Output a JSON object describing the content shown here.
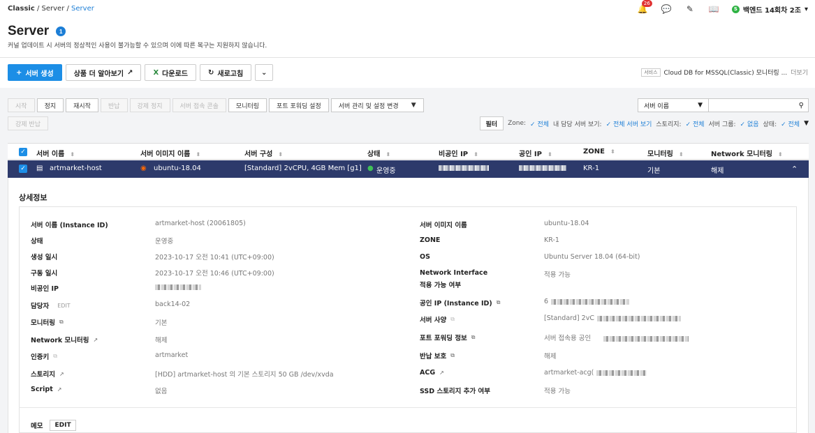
{
  "breadcrumb": {
    "root": "Classic",
    "mid": "Server",
    "current": "Server"
  },
  "top": {
    "notif_count": "26",
    "user_initial": "S",
    "user_name": "백엔드 14회차 2조"
  },
  "page": {
    "title": "Server",
    "count": "1",
    "description": "커널 업데이트 시 서버의 정상적인 사용이 불가능할 수 있으며 이에 따른 복구는 지원하지 않습니다."
  },
  "actions": {
    "create": "서버 생성",
    "learn_more": "상품 더 알아보기",
    "download": "다운로드",
    "refresh": "새로고침"
  },
  "notice": {
    "tag": "서비스",
    "text": "Cloud DB for MSSQL(Classic) 모니터링 ...",
    "more": "더보기"
  },
  "toolbar": {
    "start": "시작",
    "stop": "정지",
    "restart": "재시작",
    "return": "반납",
    "force_stop": "강제 정지",
    "console": "서버 접속 콘솔",
    "monitoring": "모니터링",
    "port_forward": "포트 포워딩 설정",
    "manage": "서버 관리 및 설정 변경",
    "force_return": "강제 반납"
  },
  "search": {
    "field": "서버 이름",
    "placeholder": ""
  },
  "filter": {
    "label": "필터",
    "zone_label": "Zone:",
    "zone_val": "전체",
    "mine_label": "내 담당 서버 보기:",
    "mine_val": "전체 서버 보기",
    "storage_label": "스토리지:",
    "storage_val": "전체",
    "group_label": "서버 그룹:",
    "group_val": "없음",
    "state_label": "상태:",
    "state_val": "전체"
  },
  "table": {
    "headers": {
      "name": "서버 이름",
      "image": "서버 이미지 이름",
      "spec": "서버 구성",
      "state": "상태",
      "private_ip": "비공인 IP",
      "public_ip": "공인 IP",
      "zone": "ZONE",
      "monitoring": "모니터링",
      "net_monitoring": "Network 모니터링"
    },
    "row": {
      "name": "artmarket-host",
      "image": "ubuntu-18.04",
      "spec": "[Standard] 2vCPU, 4GB Mem [g1]",
      "state": "운영중",
      "zone": "KR-1",
      "monitoring": "기본",
      "net_monitoring": "해제"
    }
  },
  "detail": {
    "title": "상세정보",
    "left": {
      "name_label": "서버 이름 (Instance ID)",
      "name_val": "artmarket-host (20061805)",
      "state_label": "상태",
      "state_val": "운영중",
      "created_label": "생성 일시",
      "created_val": "2023-10-17 오전 10:41 (UTC+09:00)",
      "running_label": "구동 일시",
      "running_val": "2023-10-17 오전 10:46 (UTC+09:00)",
      "pip_label": "비공인 IP",
      "owner_label": "담당자",
      "owner_edit": "EDIT",
      "owner_val": "back14-02",
      "mon_label": "모니터링",
      "mon_val": "기본",
      "netmon_label": "Network 모니터링",
      "netmon_val": "해제",
      "key_label": "인증키",
      "key_val": "artmarket",
      "storage_label": "스토리지",
      "storage_val": "[HDD] artmarket-host 의 기본 스토리지  50 GB /dev/xvda",
      "script_label": "Script",
      "script_val": "없음"
    },
    "right": {
      "image_label": "서버 이미지 이름",
      "image_val": "ubuntu-18.04",
      "zone_label": "ZONE",
      "zone_val": "KR-1",
      "os_label": "OS",
      "os_val": "Ubuntu Server 18.04 (64-bit)",
      "ni_label1": "Network Interface",
      "ni_label2": "적용 가능 여부",
      "ni_val": "적용 가능",
      "pub_label": "공인 IP (Instance ID)",
      "pub_val": "6",
      "spec_label": "서버 사양",
      "spec_val": "[Standard] 2vC",
      "pf_label": "포트 포워딩 정보",
      "pf_val": "서버 접속용 공인",
      "ret_label": "반납 보호",
      "ret_val": "해제",
      "acg_label": "ACG",
      "acg_val": "artmarket-acg(",
      "ssd_label": "SSD 스토리지 추가 여부",
      "ssd_val": "적용 가능"
    },
    "memo_label": "메모",
    "memo_edit": "EDIT"
  }
}
